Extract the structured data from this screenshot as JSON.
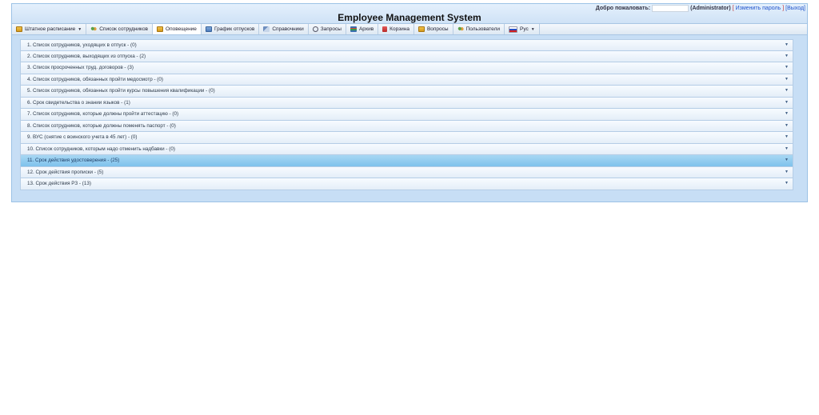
{
  "header": {
    "welcome_label": "Добро пожаловать:",
    "role": "(Administrator)",
    "bracket_open": "[",
    "change_password": "Изменить пароль",
    "bracket_close": "]",
    "logout": "[Выход]",
    "app_title": "Employee Management System"
  },
  "menu": {
    "items": [
      {
        "label": "Штатное расписание",
        "icon": "grid-icon",
        "has_dropdown": true
      },
      {
        "label": "Список сотрудников",
        "icon": "users-icon"
      },
      {
        "label": "Оповещение",
        "icon": "grid-icon",
        "active": true
      },
      {
        "label": "График отпусков",
        "icon": "schedule-icon"
      },
      {
        "label": "Справочники",
        "icon": "book-icon"
      },
      {
        "label": "Запросы",
        "icon": "search-icon"
      },
      {
        "label": "Архив",
        "icon": "archive-icon"
      },
      {
        "label": "Корзина",
        "icon": "trash-icon"
      },
      {
        "label": "Вопросы",
        "icon": "help-icon"
      },
      {
        "label": "Пользователи",
        "icon": "users-icon"
      },
      {
        "label": "Рус",
        "icon": "flag-icon",
        "has_dropdown": true
      }
    ],
    "dropdown_caret": "▼"
  },
  "notifications": {
    "rows": [
      "1. Список сотрудников, уходящих в отпуск - (0)",
      "2. Список сотрудников, выходящих из отпуска - (2)",
      "3. Список просроченных труд. договоров - (3)",
      "4. Список сотрудников, обязанных пройти медосмотр - (0)",
      "5. Список сотрудников, обязанных пройти курсы повышения квалификации - (0)",
      "6. Срок свидетельства о знании языков - (1)",
      "7. Список сотрудников, которые должны пройти аттестацию - (0)",
      "8. Список сотрудников, которые должны поменять паспорт - (0)",
      "9. ВУС (снятие с воинского учета в 45 лет) - (0)",
      "10. Список сотрудников, которым надо отменить надбавки - (0)",
      "11. Срок действия удостоверения - (25)",
      "12. Срок действия прописки - (5)",
      "13. Срок действия РЗ - (13)"
    ],
    "selected_index": 10,
    "arrow": "▼"
  },
  "colors": {
    "accent": "#7fc2ec",
    "frame": "#c7def5",
    "link": "#2255cc"
  }
}
